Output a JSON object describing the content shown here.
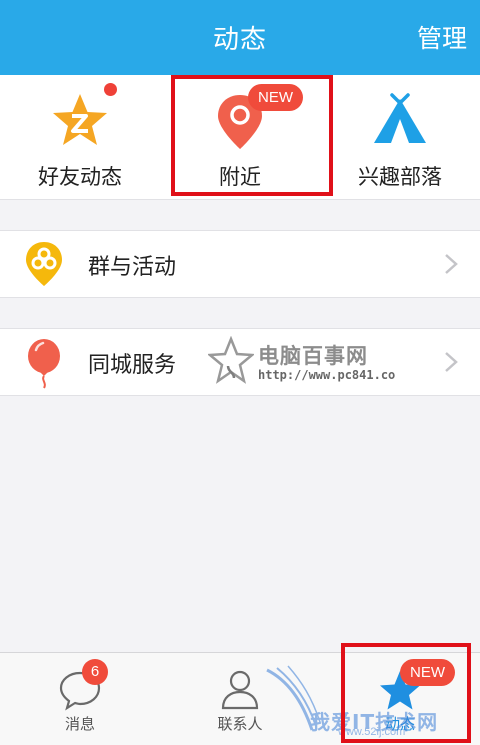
{
  "header": {
    "title": "动态",
    "manage_label": "管理",
    "background": "#29a9e8"
  },
  "features": [
    {
      "id": "friends",
      "label": "好友动态",
      "icon": "star-icon",
      "has_dot": true
    },
    {
      "id": "nearby",
      "label": "附近",
      "icon": "location-pin-icon",
      "badge": "NEW",
      "highlighted": true
    },
    {
      "id": "tribe",
      "label": "兴趣部落",
      "icon": "tent-icon"
    }
  ],
  "rows": [
    {
      "label": "群与活动",
      "icon": "group-pin-icon"
    },
    {
      "label": "同城服务",
      "icon": "balloon-icon"
    }
  ],
  "watermarks": {
    "top_title": "电脑百事网",
    "top_url": "http://www.pc841.co",
    "bottom_title": "我爱IT技术网",
    "bottom_url": "www.52ij.com"
  },
  "tabs": [
    {
      "label": "消息",
      "icon": "chat-bubble-icon",
      "count": "6"
    },
    {
      "label": "联系人",
      "icon": "contacts-icon"
    },
    {
      "label": "动态",
      "icon": "star-icon",
      "badge": "NEW",
      "active": true,
      "highlighted": true
    }
  ],
  "colors": {
    "accent": "#29a9e8",
    "badge": "#f04b3b",
    "highlight_box": "#e01019",
    "star_yellow": "#f5a623",
    "pin_red": "#f0604c",
    "tent_blue": "#1ea0e6"
  }
}
